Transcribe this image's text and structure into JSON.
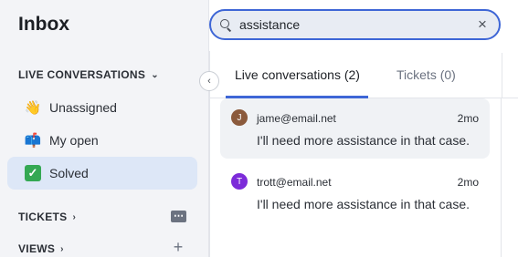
{
  "sidebar": {
    "title": "Inbox",
    "live_header": "LIVE CONVERSATIONS",
    "items": [
      {
        "label": "Unassigned",
        "icon": "waving-hand-icon",
        "glyph": "👋"
      },
      {
        "label": "My open",
        "icon": "mailbox-icon",
        "glyph": "📫"
      },
      {
        "label": "Solved",
        "icon": "check-mark-icon",
        "glyph": "✓"
      }
    ],
    "tickets_header": "TICKETS",
    "views_header": "VIEWS"
  },
  "search": {
    "value": "assistance",
    "placeholder": ""
  },
  "tabs": [
    {
      "label": "Live conversations (2)",
      "active": true
    },
    {
      "label": "Tickets (0)",
      "active": false
    }
  ],
  "conversations": [
    {
      "initial": "J",
      "email": "jame@email.net",
      "time": "2mo",
      "preview": "I'll need more assistance in that case.",
      "avatar_color": "#8b5a3c"
    },
    {
      "initial": "T",
      "email": "trott@email.net",
      "time": "2mo",
      "preview": "I'll need more assistance in that case.",
      "avatar_color": "#7c2bd9"
    }
  ],
  "colors": {
    "accent": "#3e66d6",
    "active_item_bg": "#dde7f7"
  }
}
